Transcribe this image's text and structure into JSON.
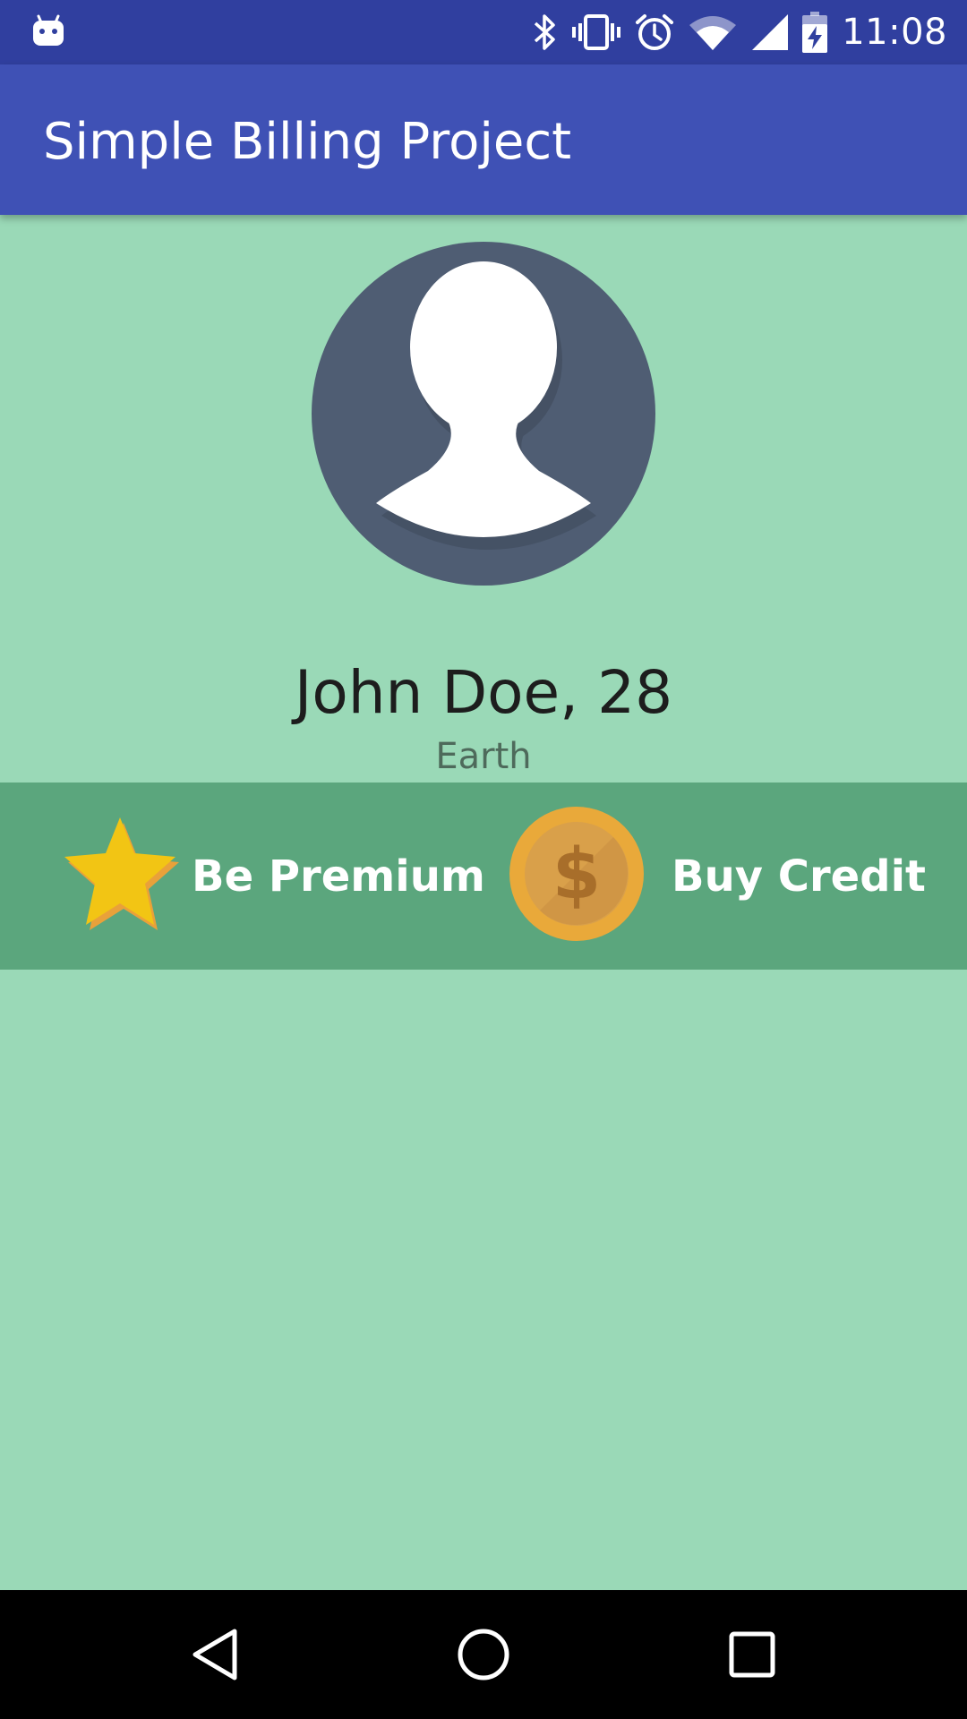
{
  "status_bar": {
    "time": "11:08",
    "icons": [
      "android-debug-icon",
      "bluetooth-icon",
      "vibrate-icon",
      "alarm-icon",
      "wifi-icon",
      "signal-icon",
      "battery-charging-icon"
    ]
  },
  "app_bar": {
    "title": "Simple Billing Project"
  },
  "profile": {
    "avatar_icon": "user-avatar-icon",
    "name": "John Doe, 28",
    "location": "Earth"
  },
  "actions": [
    {
      "label": "Be Premium",
      "icon": "star-icon"
    },
    {
      "label": "Buy Credit",
      "icon": "dollar-coin-icon"
    }
  ],
  "nav_bar": {
    "buttons": [
      "back-icon",
      "home-icon",
      "recents-icon"
    ]
  },
  "colors": {
    "status_bar": "#303f9f",
    "app_bar": "#3f51b5",
    "background": "#9ad9b7",
    "action_bar": "#5ba67d",
    "avatar": "#4f5d73",
    "star": "#f2c514",
    "coin": "#e9a93a"
  }
}
